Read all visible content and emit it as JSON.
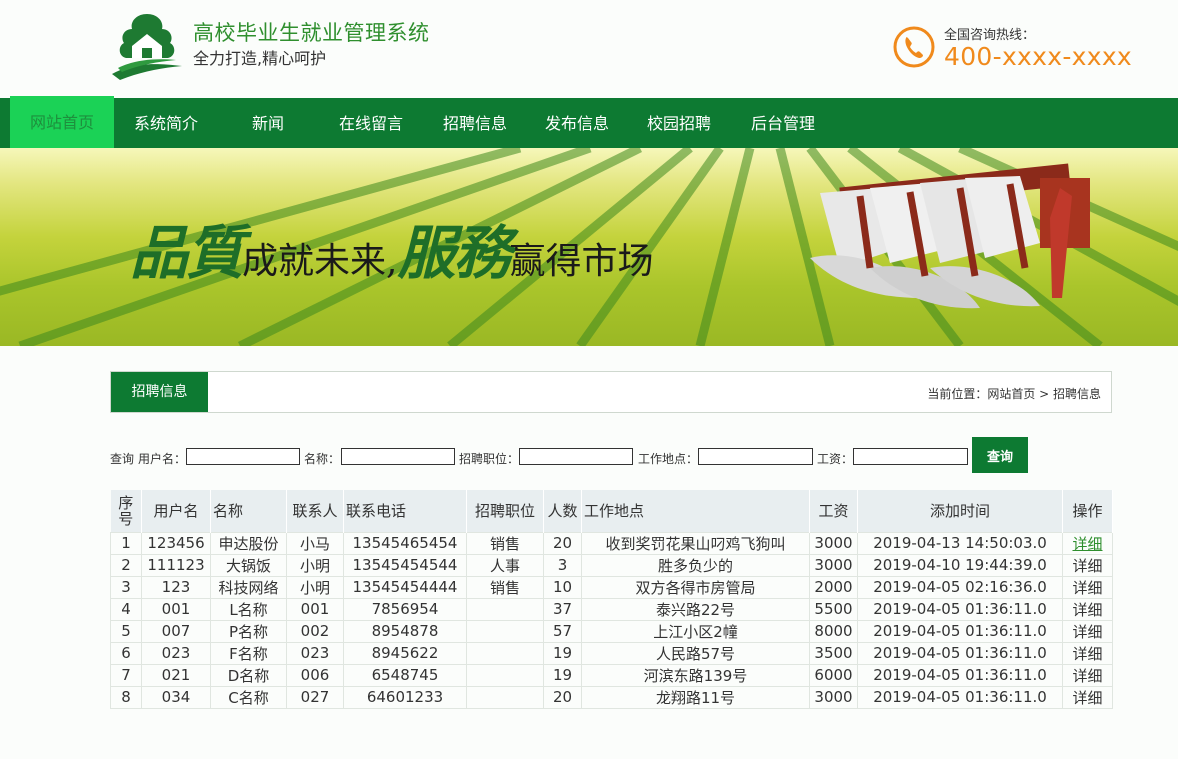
{
  "header": {
    "title": "高校毕业生就业管理系统",
    "slogan": "全力打造,精心呵护",
    "hotline_label": "全国咨询热线：",
    "hotline_number": "400-xxxx-xxxx",
    "brand_color": "#2f8f2e",
    "accent_color": "#f08a1c"
  },
  "nav": {
    "items": [
      {
        "label": "网站首页",
        "active": true
      },
      {
        "label": "系统简介"
      },
      {
        "label": "新闻"
      },
      {
        "label": "在线留言"
      },
      {
        "label": "招聘信息"
      },
      {
        "label": "发布信息"
      },
      {
        "label": "校园招聘"
      },
      {
        "label": "后台管理"
      }
    ],
    "bg_color": "#0d7a32"
  },
  "banner": {
    "part1": "品質",
    "part2": "成就未来,",
    "part3": "服務",
    "part4": "赢得市场"
  },
  "section": {
    "tab": "招聘信息",
    "breadcrumb": "当前位置：网站首页 > 招聘信息"
  },
  "search": {
    "prefix": "查询",
    "username_label": "用户名：",
    "name_label": "名称：",
    "position_label": "招聘职位：",
    "location_label": "工作地点：",
    "salary_label": "工资：",
    "button": "查询"
  },
  "table": {
    "headers": {
      "seq": "序号",
      "username": "用户名",
      "name": "名称",
      "contact": "联系人",
      "phone": "联系电话",
      "position": "招聘职位",
      "count": "人数",
      "location": "工作地点",
      "salary": "工资",
      "added": "添加时间",
      "op": "操作"
    },
    "action_label": "详细",
    "rows": [
      {
        "seq": "1",
        "username": "123456",
        "name": "申达股份",
        "contact": "小马",
        "phone": "13545465454",
        "position": "销售",
        "count": "20",
        "location": "收到奖罚花果山叼鸡飞狗叫",
        "salary": "3000",
        "added": "2019-04-13 14:50:03.0"
      },
      {
        "seq": "2",
        "username": "111123",
        "name": "大锅饭",
        "contact": "小明",
        "phone": "13545454544",
        "position": "人事",
        "count": "3",
        "location": "胜多负少的",
        "salary": "3000",
        "added": "2019-04-10 19:44:39.0"
      },
      {
        "seq": "3",
        "username": "123",
        "name": "科技网络",
        "contact": "小明",
        "phone": "13545454444",
        "position": "销售",
        "count": "10",
        "location": "双方各得市房管局",
        "salary": "2000",
        "added": "2019-04-05 02:16:36.0"
      },
      {
        "seq": "4",
        "username": "001",
        "name": "L名称",
        "contact": "001",
        "phone": "7856954",
        "position": "",
        "count": "37",
        "location": "泰兴路22号",
        "salary": "5500",
        "added": "2019-04-05 01:36:11.0"
      },
      {
        "seq": "5",
        "username": "007",
        "name": "P名称",
        "contact": "002",
        "phone": "8954878",
        "position": "",
        "count": "57",
        "location": "上江小区2幢",
        "salary": "8000",
        "added": "2019-04-05 01:36:11.0"
      },
      {
        "seq": "6",
        "username": "023",
        "name": "F名称",
        "contact": "023",
        "phone": "8945622",
        "position": "",
        "count": "19",
        "location": "人民路57号",
        "salary": "3500",
        "added": "2019-04-05 01:36:11.0"
      },
      {
        "seq": "7",
        "username": "021",
        "name": "D名称",
        "contact": "006",
        "phone": "6548745",
        "position": "",
        "count": "19",
        "location": "河滨东路139号",
        "salary": "6000",
        "added": "2019-04-05 01:36:11.0"
      },
      {
        "seq": "8",
        "username": "034",
        "name": "C名称",
        "contact": "027",
        "phone": "64601233",
        "position": "",
        "count": "20",
        "location": "龙翔路11号",
        "salary": "3000",
        "added": "2019-04-05 01:36:11.0"
      }
    ]
  }
}
